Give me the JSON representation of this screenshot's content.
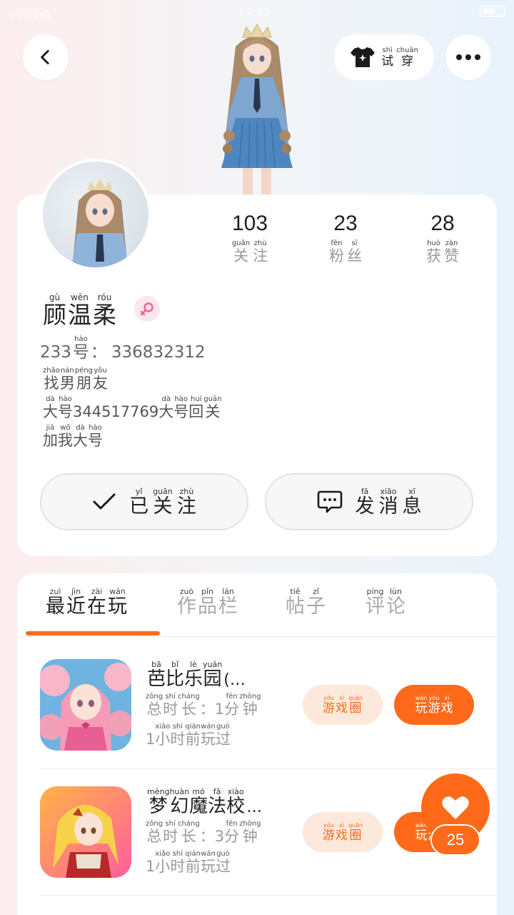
{
  "status_bar": {
    "left": "中国移动",
    "time": "09:41"
  },
  "header": {
    "try_on": {
      "pinyin": [
        "shì",
        "chuān"
      ],
      "hanzi": [
        "试",
        "穿"
      ]
    }
  },
  "stats": [
    {
      "value": "103",
      "pinyin": [
        "guān",
        "zhù"
      ],
      "hanzi": [
        "关",
        "注"
      ]
    },
    {
      "value": "23",
      "pinyin": [
        "fěn",
        "sī"
      ],
      "hanzi": [
        "粉",
        "丝"
      ]
    },
    {
      "value": "28",
      "pinyin": [
        "huò",
        "zàn"
      ],
      "hanzi": [
        "获",
        "赞"
      ]
    }
  ],
  "profile": {
    "name": {
      "pinyin": [
        "gù",
        "wēn",
        "róu"
      ],
      "hanzi": [
        "顾",
        "温",
        "柔"
      ]
    },
    "id_prefix": "233",
    "id_hao": {
      "pinyin": "hào",
      "hanzi": "号"
    },
    "id_colon": "：",
    "id_value": "336832312",
    "bio": {
      "line1": {
        "pinyin": [
          "zhǎo",
          "nán",
          "péng",
          "yǒu"
        ],
        "hanzi": [
          "找",
          "男",
          "朋",
          "友"
        ]
      },
      "line2_a": {
        "pinyin": [
          "dà",
          "hào"
        ],
        "hanzi": [
          "大",
          "号"
        ]
      },
      "line2_num": "344517769",
      "line2_b": {
        "pinyin": [
          "dà",
          "hào",
          "huí",
          "guān"
        ],
        "hanzi": [
          "大",
          "号",
          "回",
          "关"
        ]
      },
      "line3": {
        "pinyin": [
          "jiā",
          "wǒ",
          "dà",
          "hào"
        ],
        "hanzi": [
          "加",
          "我",
          "大",
          "号"
        ]
      }
    }
  },
  "actions": {
    "follow": {
      "pinyin": [
        "yǐ",
        "guān",
        "zhù"
      ],
      "hanzi": [
        "已",
        "关",
        "注"
      ]
    },
    "message": {
      "pinyin": [
        "fā",
        "xiāo",
        "xī"
      ],
      "hanzi": [
        "发",
        "消",
        "息"
      ]
    }
  },
  "tabs": [
    {
      "pinyin": [
        "zuì",
        "jìn",
        "zài",
        "wán"
      ],
      "hanzi": [
        "最",
        "近",
        "在",
        "玩"
      ]
    },
    {
      "pinyin": [
        "zuò",
        "pǐn",
        "lán"
      ],
      "hanzi": [
        "作",
        "品",
        "栏"
      ]
    },
    {
      "pinyin": [
        "tiě",
        "zǐ"
      ],
      "hanzi": [
        "帖",
        "子"
      ]
    },
    {
      "pinyin": [
        "píng",
        "lùn"
      ],
      "hanzi": [
        "评",
        "论"
      ]
    }
  ],
  "games": [
    {
      "title": {
        "pinyin": [
          "bā",
          "bǐ",
          "lè",
          "yuán"
        ],
        "hanzi": [
          "芭",
          "比",
          "乐",
          "园"
        ],
        "suffix": "(…"
      },
      "duration_label": {
        "pinyin": [
          "zǒng",
          "shí",
          "cháng"
        ],
        "hanzi": [
          "总",
          "时",
          "长"
        ]
      },
      "duration_num": "1",
      "duration_unit": {
        "pinyin": [
          "fēn",
          "zhōng"
        ],
        "hanzi": [
          "分",
          "钟"
        ]
      },
      "last_num": "1",
      "last_played": {
        "pinyin": [
          "xiǎo",
          "shí",
          "qián",
          "wán",
          "guò"
        ],
        "hanzi": [
          "小",
          "时",
          "前",
          "玩",
          "过"
        ]
      }
    },
    {
      "title": {
        "pinyin": [
          "mèng",
          "huàn",
          "mó",
          "fǎ",
          "xiào"
        ],
        "hanzi": [
          "梦",
          "幻",
          "魔",
          "法",
          "校"
        ],
        "suffix": "…"
      },
      "duration_label": {
        "pinyin": [
          "zǒng",
          "shí",
          "cháng"
        ],
        "hanzi": [
          "总",
          "时",
          "长"
        ]
      },
      "duration_num": "3",
      "duration_unit": {
        "pinyin": [
          "fēn",
          "zhōng"
        ],
        "hanzi": [
          "分",
          "钟"
        ]
      },
      "last_num": "1",
      "last_played": {
        "pinyin": [
          "xiǎo",
          "shí",
          "qián",
          "wán",
          "guò"
        ],
        "hanzi": [
          "小",
          "时",
          "前",
          "玩",
          "过"
        ]
      }
    }
  ],
  "game_buttons": {
    "circle": {
      "pinyin": [
        "yóu",
        "xì",
        "quān"
      ],
      "hanzi": [
        "游",
        "戏",
        "圈"
      ]
    },
    "play": {
      "pinyin": [
        "wán",
        "yóu",
        "xì"
      ],
      "hanzi": [
        "玩",
        "游",
        "戏"
      ]
    }
  },
  "colon": "：",
  "like_count": "25",
  "colors": {
    "accent": "#ff6a1a",
    "accent_soft": "#fde9dc",
    "gender_pink": "#f0628d"
  }
}
